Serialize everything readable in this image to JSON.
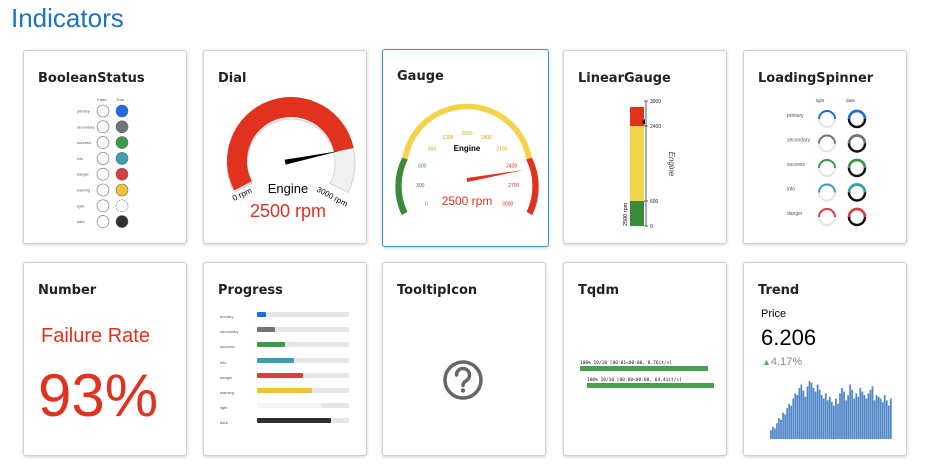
{
  "page_title": "Indicators",
  "colors": {
    "primary": "#1c6fe0",
    "secondary": "#6c757d",
    "success": "#3a9a46",
    "info": "#37a0b4",
    "danger": "#d64040",
    "warning": "#f3c137",
    "light": "#f4f4f4",
    "dark": "#2d2f32",
    "accent": "#1a73c7",
    "red": "#e0321e"
  },
  "cards": {
    "boolean_status": {
      "title": "BooleanStatus",
      "col_false": "False",
      "col_true": "True",
      "rows": [
        "primary",
        "secondary",
        "success",
        "info",
        "danger",
        "warning",
        "light",
        "dark"
      ]
    },
    "dial": {
      "title": "Dial",
      "name": "Engine",
      "value_text": "2500 rpm",
      "min_label": "0 rpm",
      "max_label": "3000 rpm",
      "value": 2500,
      "max": 3000
    },
    "gauge": {
      "title": "Gauge",
      "name": "Engine",
      "value_text": "2500 rpm",
      "value": 2500,
      "max": 3000,
      "ticks": [
        "0",
        "300",
        "600",
        "900",
        "1200",
        "1500",
        "1800",
        "2100",
        "2400",
        "2700",
        "3000"
      ]
    },
    "linear_gauge": {
      "title": "LinearGauge",
      "axis_label": "Engine",
      "value_label": "2500 rpm",
      "ticks": [
        "3000",
        "2400",
        "600",
        "0"
      ],
      "value": 2500,
      "max": 3000
    },
    "loading_spinner": {
      "title": "LoadingSpinner",
      "col_light": "light",
      "col_dark": "dark",
      "rows": [
        "primary",
        "secondary",
        "success",
        "info",
        "danger"
      ]
    },
    "number": {
      "title": "Number",
      "name": "Failure Rate",
      "value": "93%"
    },
    "progress": {
      "title": "Progress",
      "rows": [
        {
          "label": "primary",
          "value": 0.1
        },
        {
          "label": "secondary",
          "value": 0.2
        },
        {
          "label": "success",
          "value": 0.3
        },
        {
          "label": "info",
          "value": 0.4
        },
        {
          "label": "danger",
          "value": 0.5
        },
        {
          "label": "warning",
          "value": 0.6
        },
        {
          "label": "light",
          "value": 0.7
        },
        {
          "label": "dark",
          "value": 0.8
        }
      ]
    },
    "tooltip_icon": {
      "title": "TooltipIcon",
      "icon": "question-circle-icon"
    },
    "tqdm": {
      "title": "Tqdm",
      "line1": "100% 10/10 [00:01<00:00,  8.76it/s]",
      "line2": "100% 10/10 [00:00<00:00, 64.41it/s]",
      "bar1": 1.0,
      "bar2": 1.0
    },
    "trend": {
      "title": "Trend",
      "name": "Price",
      "value": "6.206",
      "change": "4.17%",
      "values": [
        10,
        14,
        12,
        18,
        24,
        22,
        30,
        28,
        35,
        40,
        38,
        46,
        52,
        50,
        58,
        62,
        55,
        48,
        60,
        66,
        64,
        58,
        54,
        62,
        56,
        50,
        46,
        52,
        44,
        48,
        42,
        38,
        46,
        40,
        52,
        58,
        54,
        44,
        50,
        62,
        56,
        46,
        52,
        48,
        58,
        54,
        50,
        46,
        52,
        56,
        60,
        44,
        50,
        48,
        46,
        42,
        50,
        44,
        38,
        46
      ]
    }
  }
}
